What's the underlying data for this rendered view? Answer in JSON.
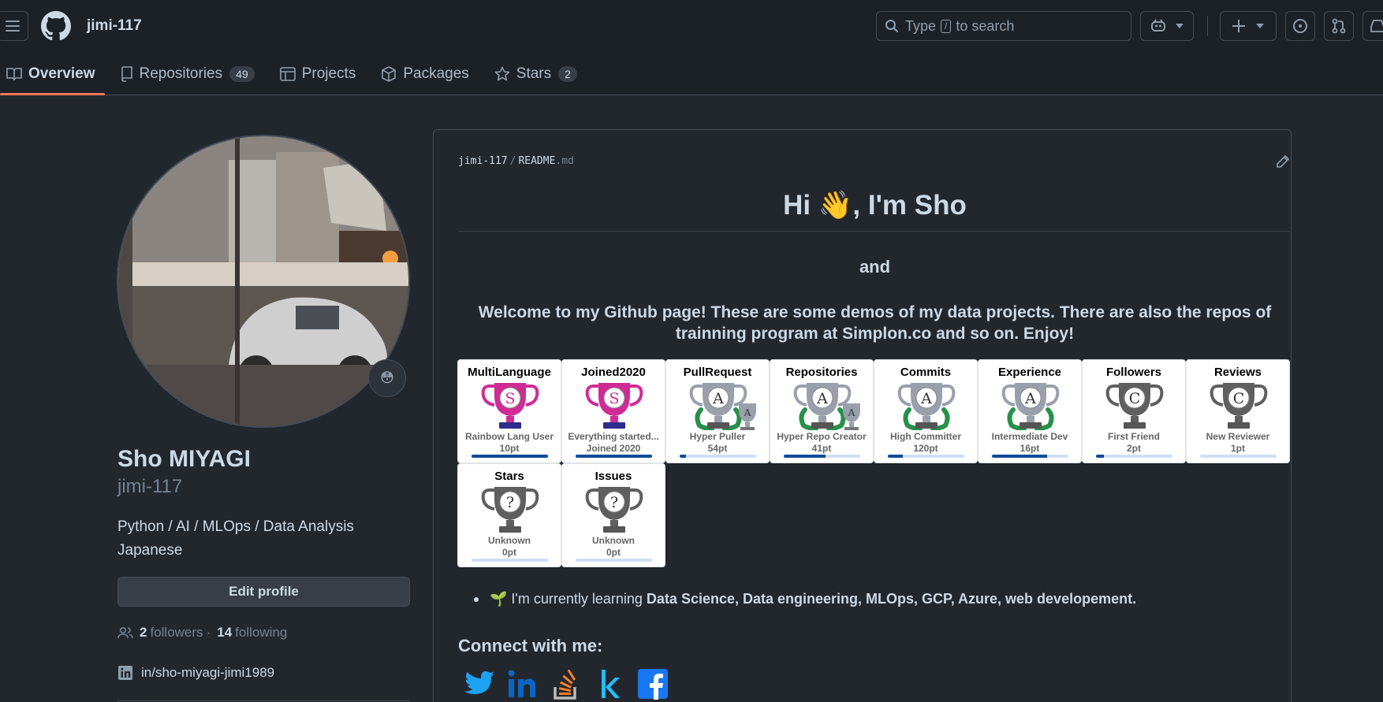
{
  "header": {
    "username": "jimi-117",
    "search_pre": "Type",
    "search_key": "/",
    "search_post": "to search"
  },
  "nav": {
    "tabs": [
      {
        "label": "Overview"
      },
      {
        "label": "Repositories",
        "count": "49"
      },
      {
        "label": "Projects"
      },
      {
        "label": "Packages"
      },
      {
        "label": "Stars",
        "count": "2"
      }
    ]
  },
  "profile": {
    "status_emoji": "😳",
    "fullname": "Sho MIYAGI",
    "login": "jimi-117",
    "bio_line1": "Python / AI / MLOps / Data Analysis",
    "bio_line2": "Japanese",
    "edit_label": "Edit profile",
    "followers_count": "2",
    "followers_label": "followers",
    "separator": "·",
    "following_count": "14",
    "following_label": "following",
    "linkedin": "in/sho-miyagi-jimi1989"
  },
  "readme": {
    "path_user": "jimi-117",
    "path_sep": "/",
    "path_file": "README",
    "path_ext": ".md",
    "heading": "Hi 👋, I'm Sho",
    "and": "and",
    "welcome": "Welcome to my Github page! These are some demos of my data projects. There are also the repos of trainning program at Simplon.co and so on. Enjoy!",
    "trophies": [
      {
        "title": "MultiLanguage",
        "rank": "S",
        "name": "Rainbow Lang User",
        "points": "10pt",
        "progress": 1.0
      },
      {
        "title": "Joined2020",
        "rank": "S",
        "name": "Everything started...",
        "points": "Joined 2020",
        "progress": 1.0
      },
      {
        "title": "PullRequest",
        "rank": "A",
        "name": "Hyper Puller",
        "points": "54pt",
        "progress": 0.08
      },
      {
        "title": "Repositories",
        "rank": "A",
        "name": "Hyper Repo Creator",
        "points": "41pt",
        "progress": 0.55
      },
      {
        "title": "Commits",
        "rank": "A",
        "name": "High Committer",
        "points": "120pt",
        "progress": 0.2
      },
      {
        "title": "Experience",
        "rank": "A",
        "name": "Intermediate Dev",
        "points": "16pt",
        "progress": 0.72
      },
      {
        "title": "Followers",
        "rank": "C",
        "name": "First Friend",
        "points": "2pt",
        "progress": 0.1
      },
      {
        "title": "Reviews",
        "rank": "C",
        "name": "New Reviewer",
        "points": "1pt",
        "progress": 0.0
      },
      {
        "title": "Stars",
        "rank": "?",
        "name": "Unknown",
        "points": "0pt",
        "progress": 0.0
      },
      {
        "title": "Issues",
        "rank": "?",
        "name": "Unknown",
        "points": "0pt",
        "progress": 0.0
      }
    ],
    "learning_prefix": "🌱 I'm currently learning",
    "learning_topics": "Data Science, Data engineering, MLOps, GCP, Azure, web developement.",
    "connect_title": "Connect with me:",
    "socials": [
      "twitter-icon",
      "linkedin-icon",
      "stackoverflow-icon",
      "kaggle-icon",
      "facebook-icon"
    ]
  },
  "colors": {
    "accent_underline": "#ec775c",
    "rank_s": "#d02b95",
    "rank_a": "#9aa0ab",
    "rank_c": "#5f5f5f",
    "laurel": "#27904a",
    "progress": "#0f4c9a"
  }
}
